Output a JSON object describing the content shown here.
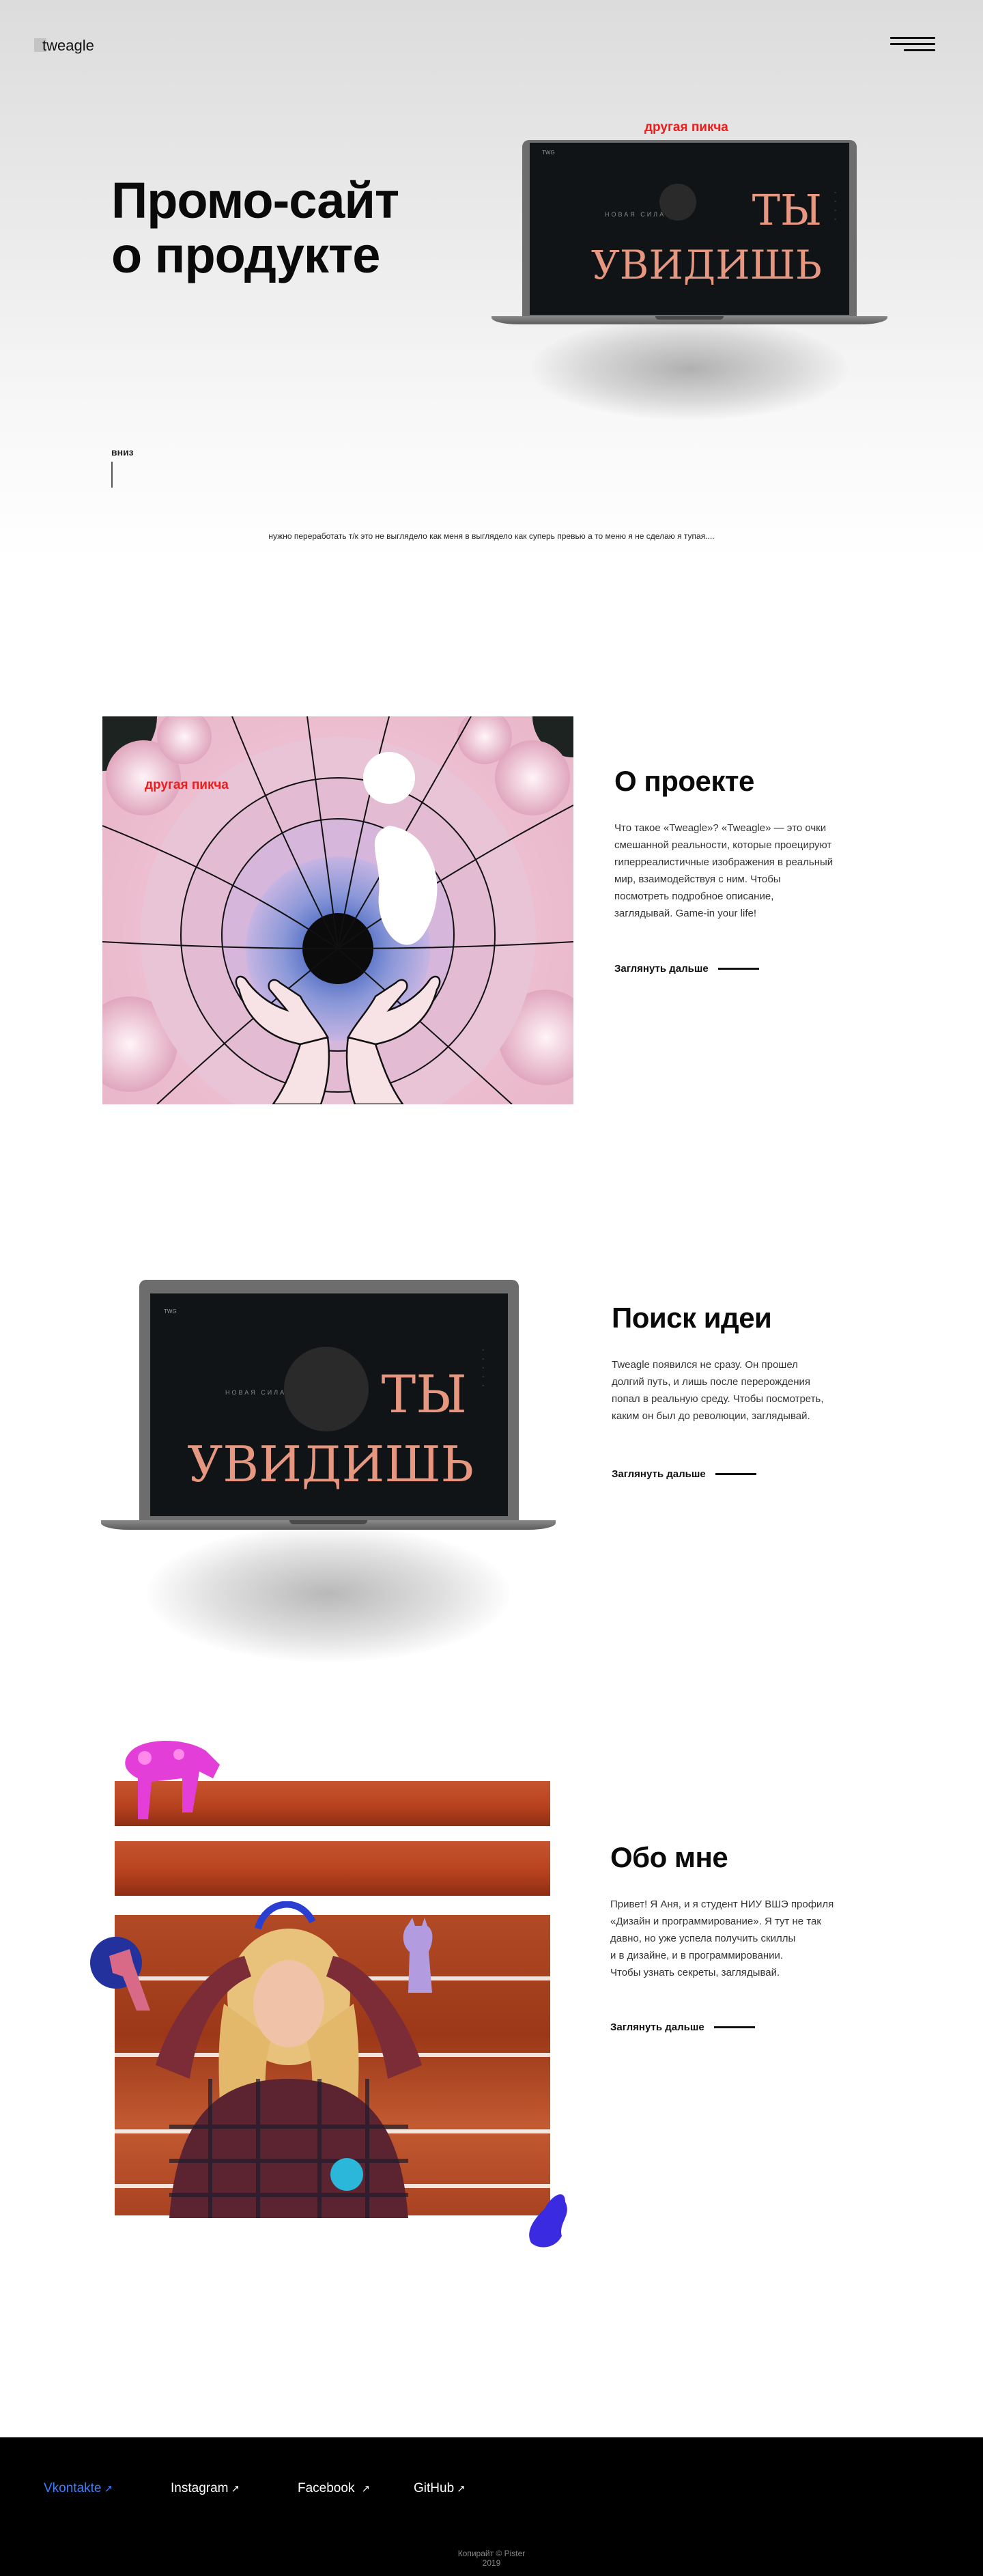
{
  "header": {
    "logo": "tweagle",
    "menu_icon": "hamburger-icon"
  },
  "hero": {
    "title_line1": "Промо-сайт",
    "title_line2": "о продукте",
    "image_caption": "другая пикча",
    "scroll_label": "вниз",
    "note": "нужно переработать т/к это не выглядело как меня в выглядело как суперь превью а то меню я не сделаю я тупая...."
  },
  "laptop_screen": {
    "line1": "ТЫ",
    "line2": "УВИДИШЬ",
    "small_text": "НОВАЯ СИЛА",
    "corner_text": "TWG"
  },
  "about_project": {
    "image_caption": "другая пикча",
    "title": "О проекте",
    "text_lines": [
      "Что такое «Tweagle»? «Tweagle» — это очки",
      "смешанной реальности, которые проецируют",
      "гиперреалистичные изображения в реальный",
      "мир, взаимодействуя с ним. Чтобы",
      "посмотреть подробное описание,",
      "заглядывай. Game-in your life!"
    ],
    "link": "Заглянуть дальше"
  },
  "idea": {
    "title": "Поиск идеи",
    "text_lines": [
      "Tweagle появился не сразу. Он прошел",
      "долгий путь, и лишь после перерождения",
      "попал в реальную среду. Чтобы посмотреть,",
      "каким он был до революции, заглядывай."
    ],
    "link": "Заглянуть дальше"
  },
  "about_me": {
    "title": "Обо мне",
    "text_lines": [
      "Привет! Я Аня, и я студент НИУ ВШЭ профиля",
      "«Дизайн и программирование». Я тут не так",
      "давно, но уже успела получить скиллы",
      "и в дизайне, и в программировании.",
      "Чтобы узнать секреты, заглядывай."
    ],
    "link": "Заглянуть дальше"
  },
  "footer": {
    "links": [
      "Vkontakte",
      "Instagram",
      "Facebook",
      "GitHub"
    ],
    "copyright_line1": "Копирайт © Pister",
    "copyright_line2": "2019"
  },
  "colors": {
    "accent_red": "#ef1c1c",
    "link_blue": "#3d7dff",
    "footer_bg": "#000000",
    "screen_text": "#e7967f"
  }
}
